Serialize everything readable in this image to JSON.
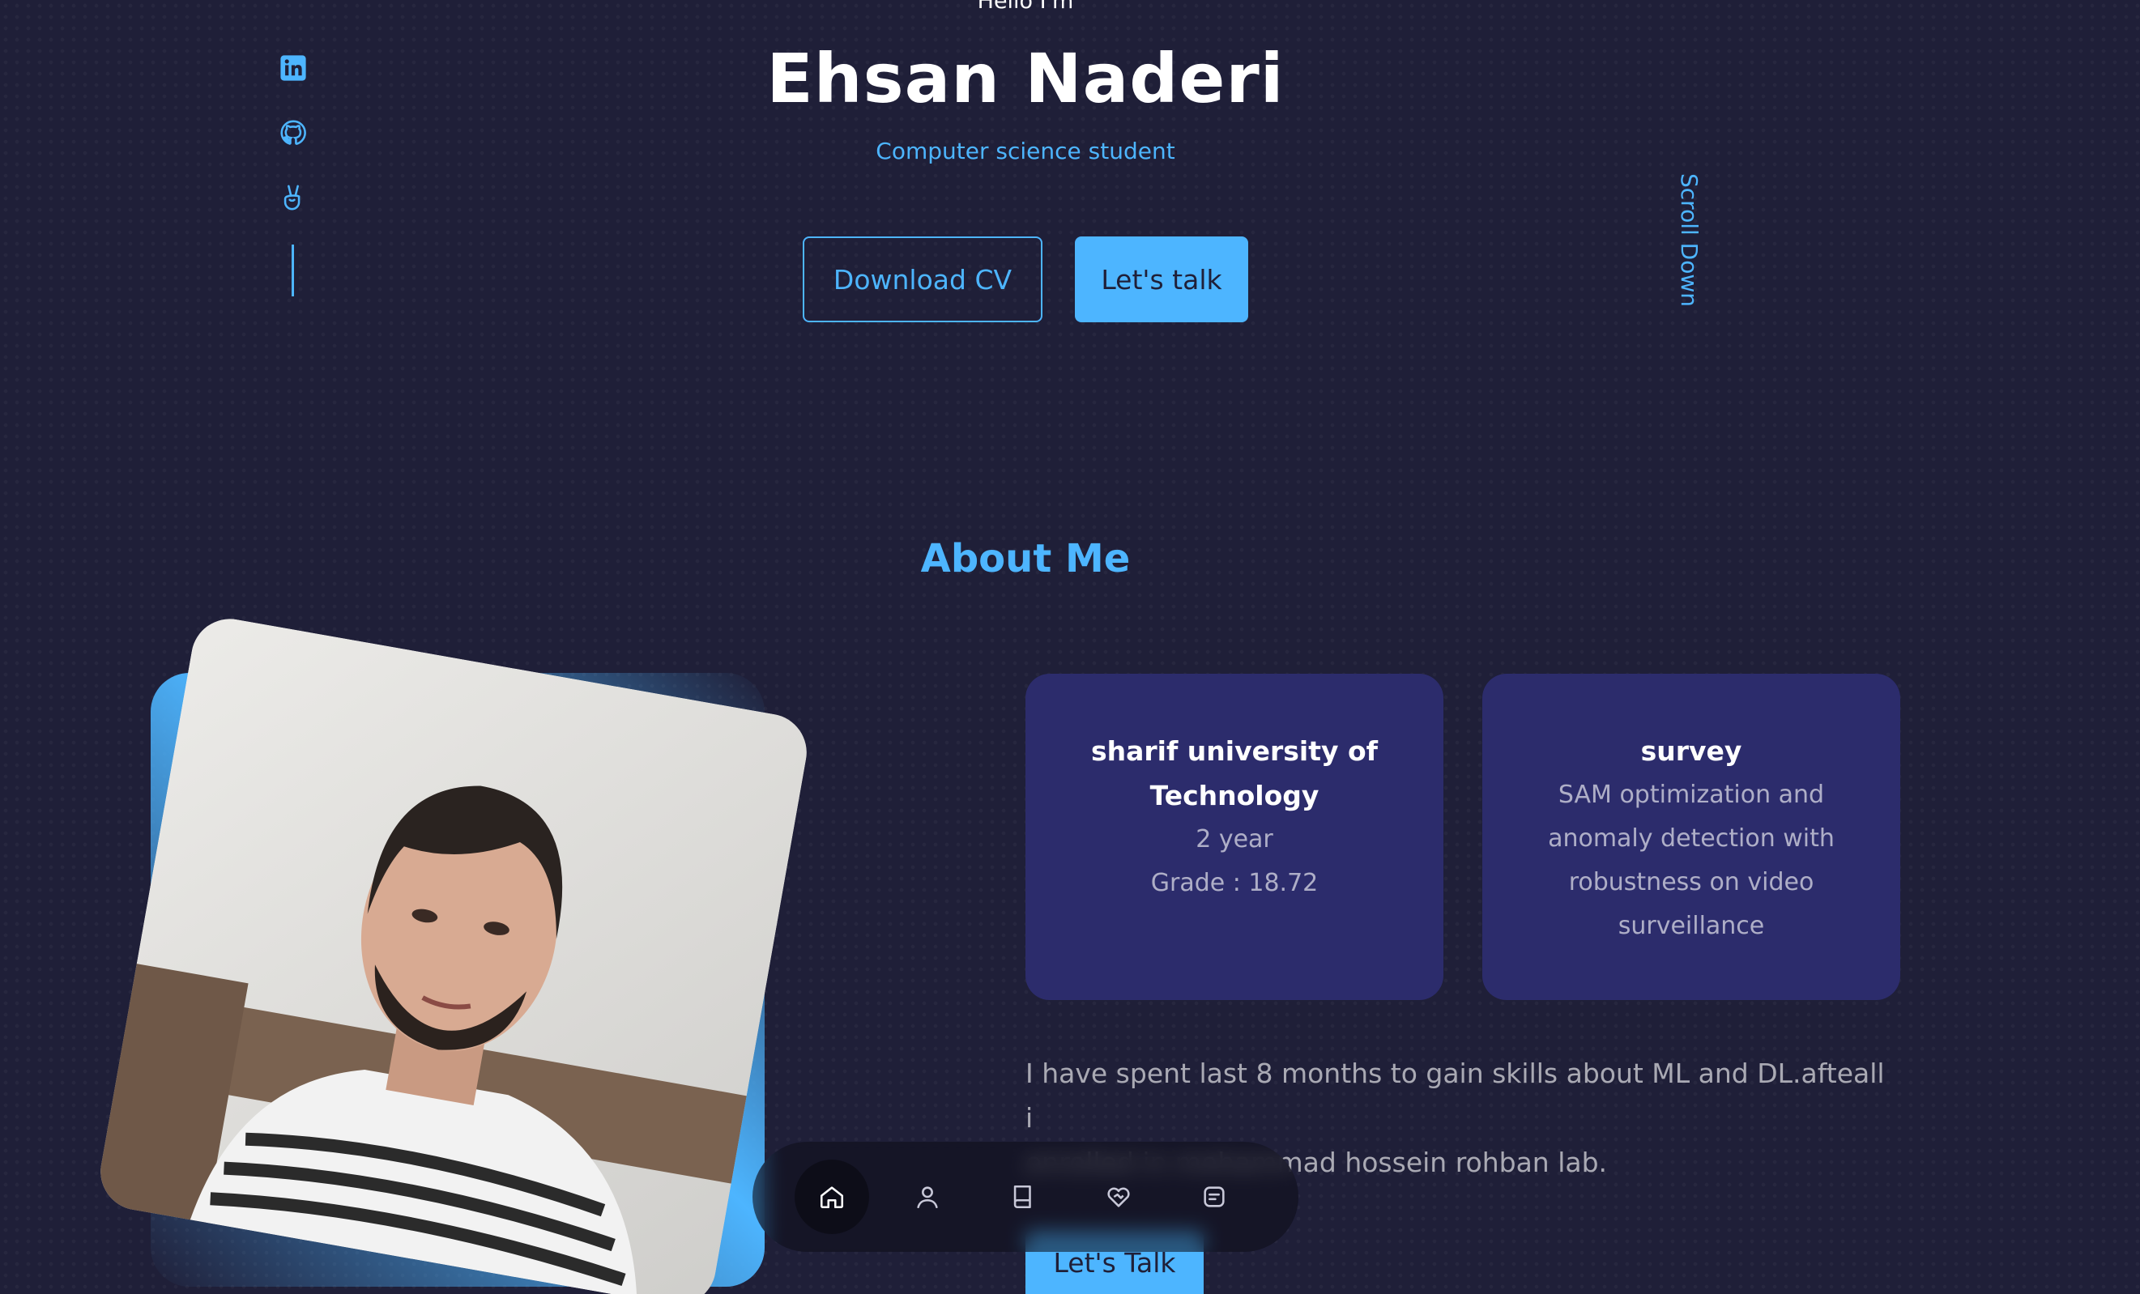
{
  "hero": {
    "greeting": "Hello I'm",
    "name": "Ehsan Naderi",
    "subtitle": "Computer science student",
    "download_cv_label": "Download CV",
    "lets_talk_label": "Let's talk",
    "scroll_down_label": "Scroll Down"
  },
  "social": {
    "icons": [
      "linkedin-icon",
      "github-icon",
      "angellist-icon"
    ]
  },
  "about": {
    "title": "About Me",
    "cards": [
      {
        "title_lines": [
          "sharif university of",
          "Technology"
        ],
        "lines": [
          "2 year",
          "Grade : 18.72"
        ]
      },
      {
        "title_lines": [
          "survey"
        ],
        "lines": [
          "SAM optimization and",
          "anomaly detection with",
          "robustness on video",
          "surveillance"
        ]
      }
    ],
    "text_lines": [
      "I have spent last 8 months to gain skills about ML and DL.afteall i",
      "enrolled in mohammad hossein rohban lab."
    ],
    "lets_talk_label": "Let's Talk"
  },
  "nav": {
    "items": [
      "home-icon",
      "user-icon",
      "book-icon",
      "services-icon",
      "message-icon"
    ],
    "active_index": 0
  },
  "colors": {
    "background": "#1f1f38",
    "accent": "#4db5ff",
    "card": "#2c2c6c"
  }
}
